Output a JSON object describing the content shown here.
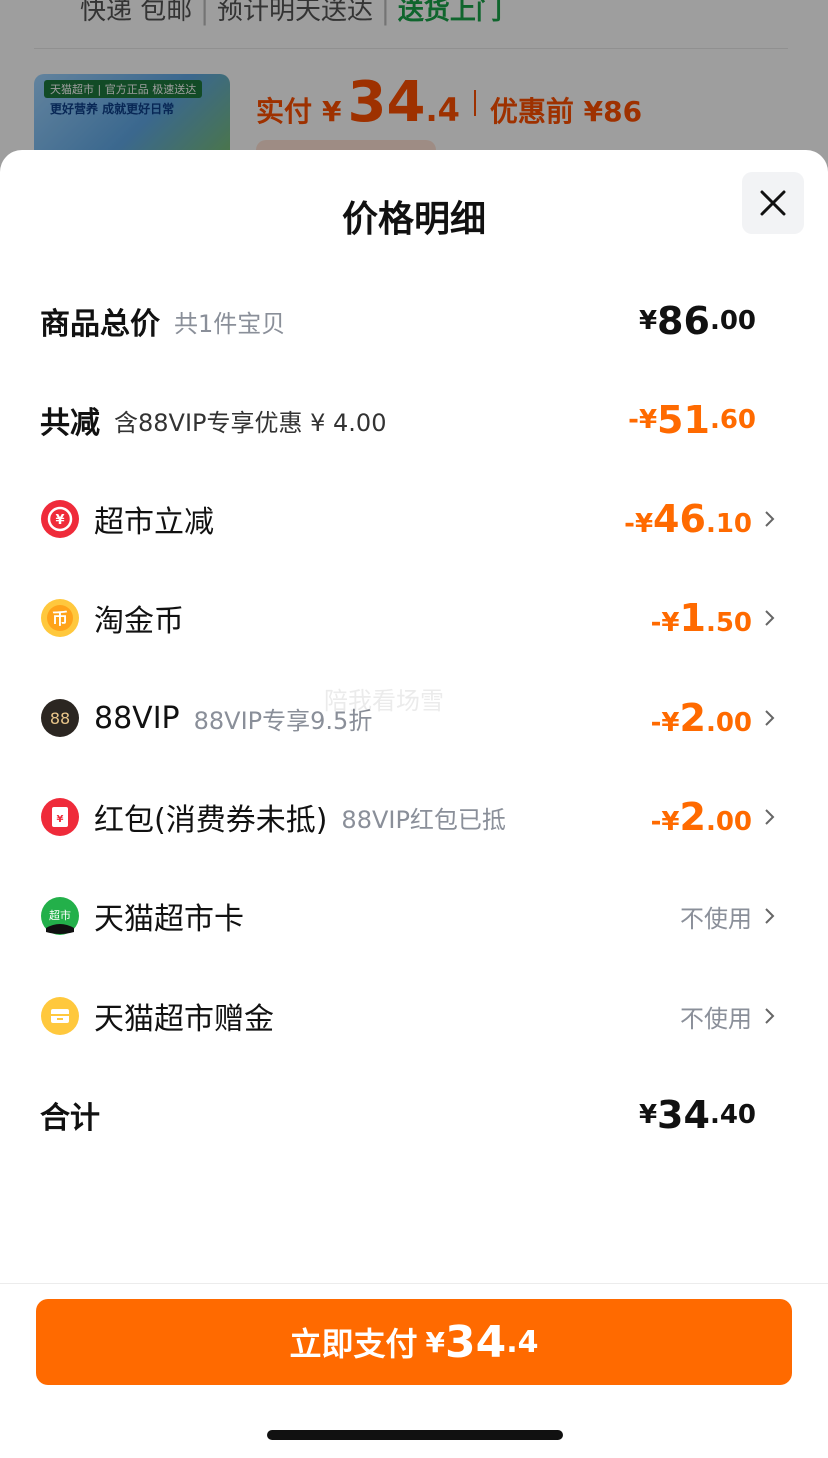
{
  "background": {
    "delivery": {
      "express": "快递 包邮",
      "estimate": "预计明天送达",
      "door": "送货上门"
    },
    "product": {
      "tag": "天猫超市 | 官方正品 极速送达",
      "slogan": "更好营养 成就更好日常"
    },
    "price": {
      "label": "实付",
      "yen": "¥",
      "int": "34",
      "dec": ".4",
      "before": "优惠前 ¥86"
    }
  },
  "sheet": {
    "title": "价格明细",
    "close_icon": "close-icon",
    "watermark": "陪我看场雪",
    "rows": [
      {
        "label": "商品总价",
        "sub": "共1件宝贝",
        "yen": "¥",
        "int": "86",
        "dec": ".00",
        "color": "#111111"
      },
      {
        "label": "共减",
        "sub": "含88VIP专享优惠 ¥ 4.00",
        "yen": "-¥",
        "int": "51",
        "dec": ".60",
        "color": "#ff6a00"
      },
      {
        "label": "超市立减",
        "icon": "red-yuan-coupon-icon",
        "yen": "-¥",
        "int": "46",
        "dec": ".10",
        "color": "#ff6a00"
      },
      {
        "label": "淘金币",
        "icon": "gold-coin-icon",
        "yen": "-¥",
        "int": "1",
        "dec": ".50",
        "color": "#ff6a00"
      },
      {
        "label": "88VIP",
        "sub": "88VIP专享9.5折",
        "icon": "88vip-icon",
        "icon_text": "88",
        "yen": "-¥",
        "int": "2",
        "dec": ".00",
        "color": "#ff6a00"
      },
      {
        "label": "红包(消费券未抵)",
        "sub": "88VIP红包已抵",
        "icon": "red-envelope-icon",
        "yen": "-¥",
        "int": "2",
        "dec": ".00",
        "color": "#ff6a00"
      },
      {
        "label": "天猫超市卡",
        "icon": "tmall-supermarket-card-icon",
        "icon_text": "超市",
        "action": "不使用"
      },
      {
        "label": "天猫超市赠金",
        "icon": "gift-money-icon",
        "action": "不使用"
      },
      {
        "label": "合计",
        "yen": "¥",
        "int": "34",
        "dec": ".40",
        "color": "#111111"
      }
    ]
  },
  "pay_button": {
    "label": "立即支付",
    "yen": "¥",
    "int": "34",
    "dec": ".4"
  },
  "colors": {
    "accent": "#ff6a00",
    "green": "#19a34a"
  }
}
